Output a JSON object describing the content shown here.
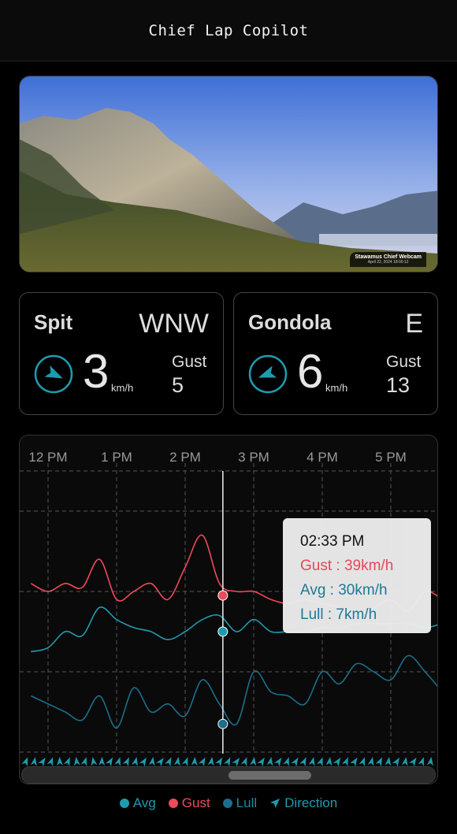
{
  "header": {
    "title": "Chief Lap Copilot"
  },
  "webcam": {
    "title": "Stawamus Chief Webcam",
    "timestamp": "April 22, 2024 18:00:12"
  },
  "stations": [
    {
      "name": "Spit",
      "direction": "WNW",
      "speed": "3",
      "unit": "km/h",
      "gust_label": "Gust",
      "gust": "5",
      "arrow_deg": 115
    },
    {
      "name": "Gondola",
      "direction": "E",
      "speed": "6",
      "unit": "km/h",
      "gust_label": "Gust",
      "gust": "13",
      "arrow_deg": 250
    }
  ],
  "colors": {
    "avg": "#1f9bb0",
    "gust": "#ef4a5a",
    "lull": "#1c6f8c",
    "direction": "#1f9bb0",
    "accent": "#1f9bb0"
  },
  "chart_data": {
    "type": "line",
    "x_tick_labels": [
      "12 PM",
      "1 PM",
      "2 PM",
      "3 PM",
      "4 PM",
      "5 PM"
    ],
    "x": [
      "11:45",
      "12:00",
      "12:15",
      "12:30",
      "12:45",
      "13:00",
      "13:15",
      "13:30",
      "13:45",
      "14:00",
      "14:15",
      "14:30",
      "14:45",
      "15:00",
      "15:15",
      "15:30",
      "15:45",
      "16:00",
      "16:15",
      "16:30",
      "16:45",
      "17:00",
      "17:15",
      "17:30",
      "17:45"
    ],
    "unit": "km/h",
    "ylim": [
      0,
      70
    ],
    "grid": true,
    "series": [
      {
        "name": "Gust",
        "color": "#ef4a5a",
        "values": [
          42,
          40,
          42,
          41,
          48,
          38,
          40,
          42,
          38,
          46,
          54,
          42,
          40,
          40,
          38,
          37,
          38,
          37,
          36,
          34,
          36,
          38,
          35,
          40,
          38
        ]
      },
      {
        "name": "Avg",
        "color": "#1f9bb0",
        "values": [
          25,
          26,
          30,
          29,
          36,
          33,
          31,
          30,
          28,
          30,
          33,
          34,
          30,
          33,
          30,
          30,
          30,
          31,
          31,
          32,
          32,
          32,
          32,
          31,
          32
        ]
      },
      {
        "name": "Lull",
        "color": "#1c6f8c",
        "values": [
          14,
          12,
          10,
          8,
          14,
          6,
          16,
          10,
          12,
          9,
          18,
          12,
          7,
          20,
          15,
          14,
          12,
          20,
          17,
          22,
          20,
          18,
          24,
          20,
          15
        ]
      }
    ],
    "direction_deg": [
      100,
      110,
      100,
      95,
      80,
      120,
      115,
      110,
      115,
      110,
      105,
      110,
      115,
      110,
      112,
      110,
      115,
      110,
      112,
      110,
      115,
      110,
      112,
      110,
      115
    ],
    "legend": [
      "Avg",
      "Gust",
      "Lull",
      "Direction"
    ],
    "legend_placement": "bottom",
    "tooltip": {
      "time": "02:33 PM",
      "gust": "Gust : 39km/h",
      "avg": "Avg : 30km/h",
      "lull": "Lull : 7km/h",
      "cursor_time": "14:33",
      "gust_value": 39,
      "avg_value": 30,
      "lull_value": 7
    },
    "scroll_position": 0.5
  }
}
